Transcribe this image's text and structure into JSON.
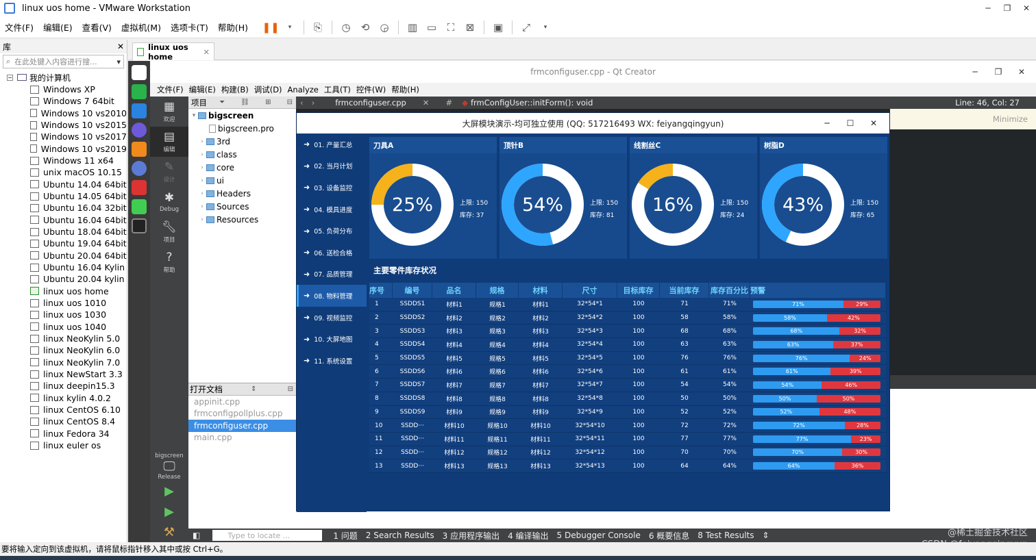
{
  "vmware": {
    "title": "linux uos home - VMware Workstation",
    "menu": [
      "文件(F)",
      "编辑(E)",
      "查看(V)",
      "虚拟机(M)",
      "选项卡(T)",
      "帮助(H)"
    ],
    "tab": "linux uos home",
    "status": "要将输入定向到该虚拟机，请将鼠标指针移入其中或按 Ctrl+G。"
  },
  "library": {
    "title": "库",
    "search_placeholder": "在此处键入内容进行搜...",
    "root": "我的计算机",
    "items": [
      "Windows XP",
      "Windows 7 64bit",
      "Windows 10 vs2010",
      "Windows 10 vs2015",
      "Windows 10 vs2017",
      "Windows 10 vs2019",
      "Windows 11 x64",
      "unix macOS 10.15",
      "Ubuntu 14.04 64bit",
      "Ubuntu 14.05 64bit",
      "Ubuntu 16.04 32bit",
      "Ubuntu 16.04 64bit",
      "Ubuntu 18.04 64bit",
      "Ubuntu 19.04 64bit",
      "Ubuntu 20.04 64bit",
      "Ubuntu 16.04 Kylin",
      "Ubuntu 20.04 kylin",
      "linux uos home",
      "linux uos 1010",
      "linux uos 1030",
      "linux uos 1040",
      "linux NeoKylin 5.0",
      "linux NeoKylin 6.0",
      "linux NeoKylin 7.0",
      "linux NewStart 3.3",
      "linux deepin15.3",
      "linux kylin 4.0.2",
      "linux CentOS 6.10",
      "linux CentOS 8.4",
      "linux Fedora 34",
      "linux euler os"
    ],
    "active_index": 17
  },
  "qt": {
    "title": "frmconfiguser.cpp - Qt Creator",
    "menu": [
      "文件(F)",
      "编辑(E)",
      "构建(B)",
      "调试(D)",
      "Analyze",
      "工具(T)",
      "控件(W)",
      "帮助(H)"
    ],
    "modes": [
      {
        "icon": "grid",
        "label": "欢迎"
      },
      {
        "icon": "edit",
        "label": "编辑"
      },
      {
        "icon": "pen",
        "label": "设计"
      },
      {
        "icon": "bug",
        "label": "Debug"
      },
      {
        "icon": "wrench",
        "label": "项目"
      },
      {
        "icon": "help",
        "label": "帮助"
      }
    ],
    "kit_name": "bigscreen",
    "kit_mode": "Release",
    "projects_label": "项目",
    "tree": [
      {
        "name": "bigscreen",
        "type": "root"
      },
      {
        "name": "bigscreen.pro",
        "type": "file"
      },
      {
        "name": "3rd",
        "type": "folder"
      },
      {
        "name": "class",
        "type": "folder"
      },
      {
        "name": "core",
        "type": "folder"
      },
      {
        "name": "ui",
        "type": "folder"
      },
      {
        "name": "Headers",
        "type": "folder"
      },
      {
        "name": "Sources",
        "type": "folder"
      },
      {
        "name": "Resources",
        "type": "folder"
      }
    ],
    "open_docs_label": "打开文档",
    "open_docs": [
      "appinit.cpp",
      "frmconfigpollplus.cpp",
      "frmconfiguser.cpp",
      "main.cpp"
    ],
    "open_docs_selected": 2,
    "editor_file": "frmconfiguser.cpp",
    "editor_function": "frmConfigUser::initForm(): void",
    "editor_pos": "Line: 46, Col: 27",
    "minimize": "Minimize",
    "locate_placeholder": "Type to locate ...",
    "output_tabs": [
      "1 问题",
      "2 Search Results",
      "3 应用程序输出",
      "4 编译输出",
      "5 Debugger Console",
      "6 概要信息",
      "8 Test Results"
    ]
  },
  "app": {
    "title": "大屏模块演示-均可独立使用 (QQ: 517216493 WX: feiyangqingyun)",
    "nav": [
      "01. 产量汇总",
      "02. 当月计划",
      "03. 设备监控",
      "04. 模具进度",
      "05. 负荷分布",
      "06. 送检合格",
      "07. 品质管理",
      "08. 物料管理",
      "09. 视频监控",
      "10. 大屏地图",
      "11. 系统设置"
    ],
    "nav_selected": 7,
    "gauges": [
      {
        "title": "刀具A",
        "percent": 25,
        "pct_text": "25%",
        "limit": "上限: 150",
        "stock": "库存: 37",
        "color": "#f5b21b"
      },
      {
        "title": "顶针B",
        "percent": 54,
        "pct_text": "54%",
        "limit": "上限: 150",
        "stock": "库存: 81",
        "color": "#2ea6ff"
      },
      {
        "title": "线割丝C",
        "percent": 16,
        "pct_text": "16%",
        "limit": "上限: 150",
        "stock": "库存: 24",
        "color": "#f5b21b"
      },
      {
        "title": "树脂D",
        "percent": 43,
        "pct_text": "43%",
        "limit": "上限: 150",
        "stock": "库存: 65",
        "color": "#2ea6ff"
      }
    ],
    "table_title": "主要零件库存状况",
    "headers": [
      "序号",
      "编号",
      "品名",
      "规格",
      "材料",
      "尺寸",
      "目标库存",
      "当前库存",
      "库存百分比",
      "预警"
    ],
    "rows": [
      [
        "1",
        "SSDDS1",
        "材料1",
        "规格1",
        "材料1",
        "32*54*1",
        "100",
        "71",
        "71%",
        "71%",
        "29%"
      ],
      [
        "2",
        "SSDDS2",
        "材料2",
        "规格2",
        "材料2",
        "32*54*2",
        "100",
        "58",
        "58%",
        "58%",
        "42%"
      ],
      [
        "3",
        "SSDDS3",
        "材料3",
        "规格3",
        "材料3",
        "32*54*3",
        "100",
        "68",
        "68%",
        "68%",
        "32%"
      ],
      [
        "4",
        "SSDDS4",
        "材料4",
        "规格4",
        "材料4",
        "32*54*4",
        "100",
        "63",
        "63%",
        "63%",
        "37%"
      ],
      [
        "5",
        "SSDDS5",
        "材料5",
        "规格5",
        "材料5",
        "32*54*5",
        "100",
        "76",
        "76%",
        "76%",
        "24%"
      ],
      [
        "6",
        "SSDDS6",
        "材料6",
        "规格6",
        "材料6",
        "32*54*6",
        "100",
        "61",
        "61%",
        "61%",
        "39%"
      ],
      [
        "7",
        "SSDDS7",
        "材料7",
        "规格7",
        "材料7",
        "32*54*7",
        "100",
        "54",
        "54%",
        "54%",
        "46%"
      ],
      [
        "8",
        "SSDDS8",
        "材料8",
        "规格8",
        "材料8",
        "32*54*8",
        "100",
        "50",
        "50%",
        "50%",
        "50%"
      ],
      [
        "9",
        "SSDDS9",
        "材料9",
        "规格9",
        "材料9",
        "32*54*9",
        "100",
        "52",
        "52%",
        "52%",
        "48%"
      ],
      [
        "10",
        "SSDD···",
        "材料10",
        "规格10",
        "材料10",
        "32*54*10",
        "100",
        "72",
        "72%",
        "72%",
        "28%"
      ],
      [
        "11",
        "SSDD···",
        "材料11",
        "规格11",
        "材料11",
        "32*54*11",
        "100",
        "77",
        "77%",
        "77%",
        "23%"
      ],
      [
        "12",
        "SSDD···",
        "材料12",
        "规格12",
        "材料12",
        "32*54*12",
        "100",
        "70",
        "70%",
        "70%",
        "30%"
      ],
      [
        "13",
        "SSDD···",
        "材料13",
        "规格13",
        "材料13",
        "32*54*13",
        "100",
        "64",
        "64%",
        "64%",
        "36%"
      ]
    ],
    "colors": {
      "bar_ok": "#2e9bf0",
      "bar_warn": "#e0373f"
    }
  },
  "watermark": [
    "@稀土掘金技术社区",
    "CSDN @feiyangqingyun"
  ]
}
